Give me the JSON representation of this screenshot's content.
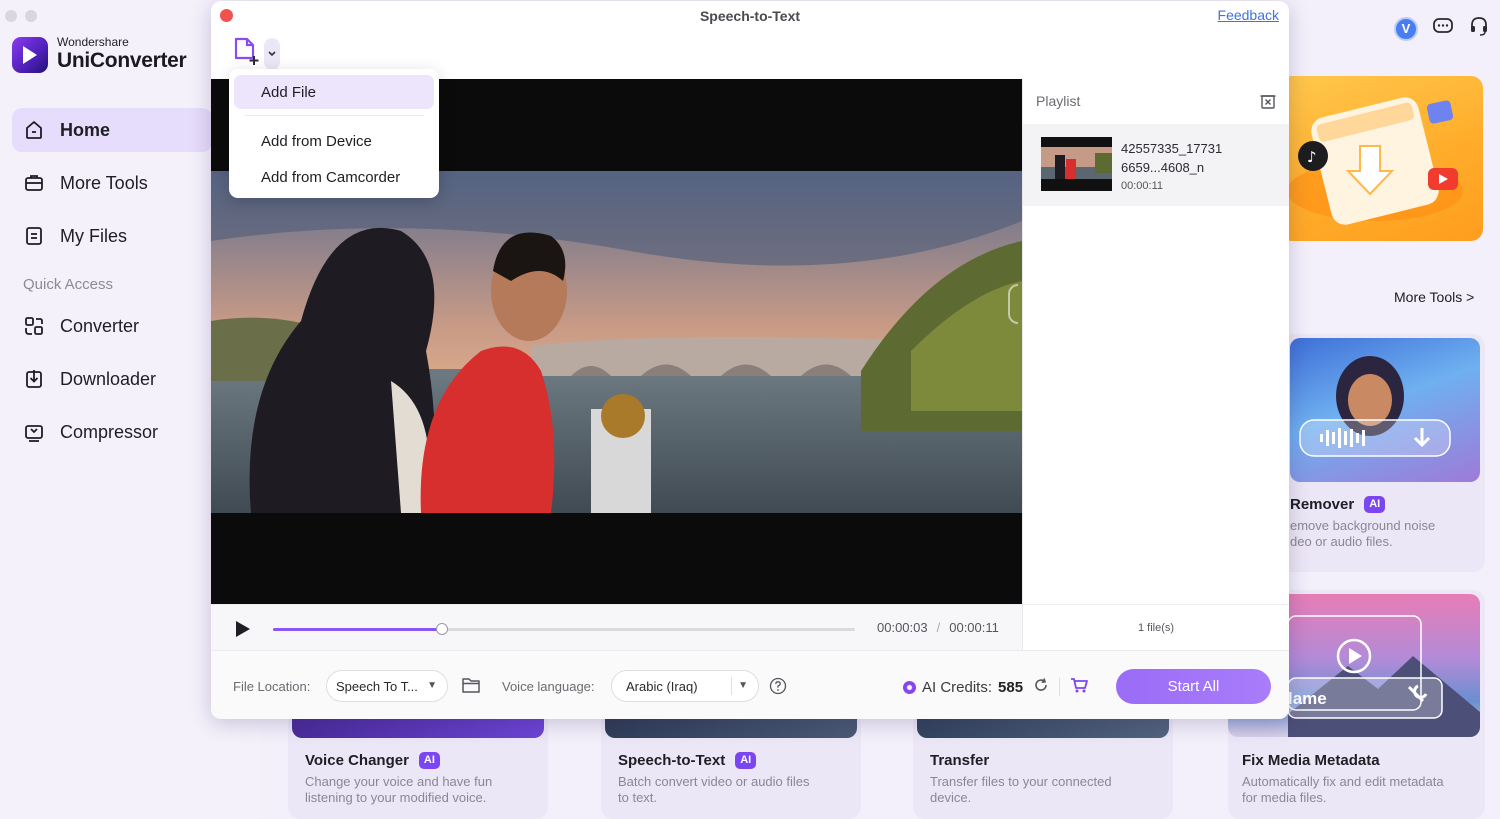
{
  "app": {
    "brand_small": "Wondershare",
    "brand_name": "UniConverter",
    "accent_color": "#7b45f0"
  },
  "sidebar": {
    "items": [
      {
        "label": "Home",
        "icon": "home-icon"
      },
      {
        "label": "More Tools",
        "icon": "toolbox-icon"
      },
      {
        "label": "My Files",
        "icon": "files-icon"
      }
    ],
    "quick_access_label": "Quick Access",
    "quick_items": [
      {
        "label": "Converter",
        "icon": "converter-icon"
      },
      {
        "label": "Downloader",
        "icon": "downloader-icon"
      },
      {
        "label": "Compressor",
        "icon": "compressor-icon"
      }
    ]
  },
  "header": {
    "avatar_letter": "V"
  },
  "background": {
    "more_tools_link": "More Tools >",
    "cards": [
      {
        "title": "Remover",
        "ai": "AI",
        "desc_line1": "emove background noise",
        "desc_line2": "deo or audio files."
      },
      {
        "title": "Voice Changer",
        "ai": "AI",
        "desc_line1": "Change your voice and have fun",
        "desc_line2": "listening to your modified voice."
      },
      {
        "title": "Speech-to-Text",
        "ai": "AI",
        "desc_line1": "Batch convert video or audio files",
        "desc_line2": "to text."
      },
      {
        "title": "Transfer",
        "desc_line1": "Transfer files to your connected",
        "desc_line2": "device."
      },
      {
        "title": "Fix Media Metadata",
        "desc_line1": "Automatically fix and edit metadata",
        "desc_line2": "for media files."
      },
      {
        "overlay_text": "lame"
      }
    ]
  },
  "dialog": {
    "title": "Speech-to-Text",
    "feedback": "Feedback",
    "menu": {
      "items": [
        "Add File",
        "Add from Device",
        "Add from Camcorder"
      ],
      "highlighted": "Add File"
    },
    "playlist": {
      "header": "Playlist",
      "items": [
        {
          "name_line1": "42557335_17731",
          "name_line2": "6659...4608_n",
          "duration": "00:00:11"
        }
      ],
      "file_count": "1 file(s)"
    },
    "player": {
      "current_time": "00:00:03",
      "separator": "/",
      "total_time": "00:00:11",
      "progress": 0.29
    },
    "bottom": {
      "file_location_label": "File Location:",
      "file_location_value": "Speech To T...",
      "voice_language_label": "Voice language:",
      "voice_language_value": "Arabic (Iraq)",
      "ai_credits_label": "AI Credits:",
      "ai_credits_value": "585",
      "start_all": "Start All"
    }
  }
}
